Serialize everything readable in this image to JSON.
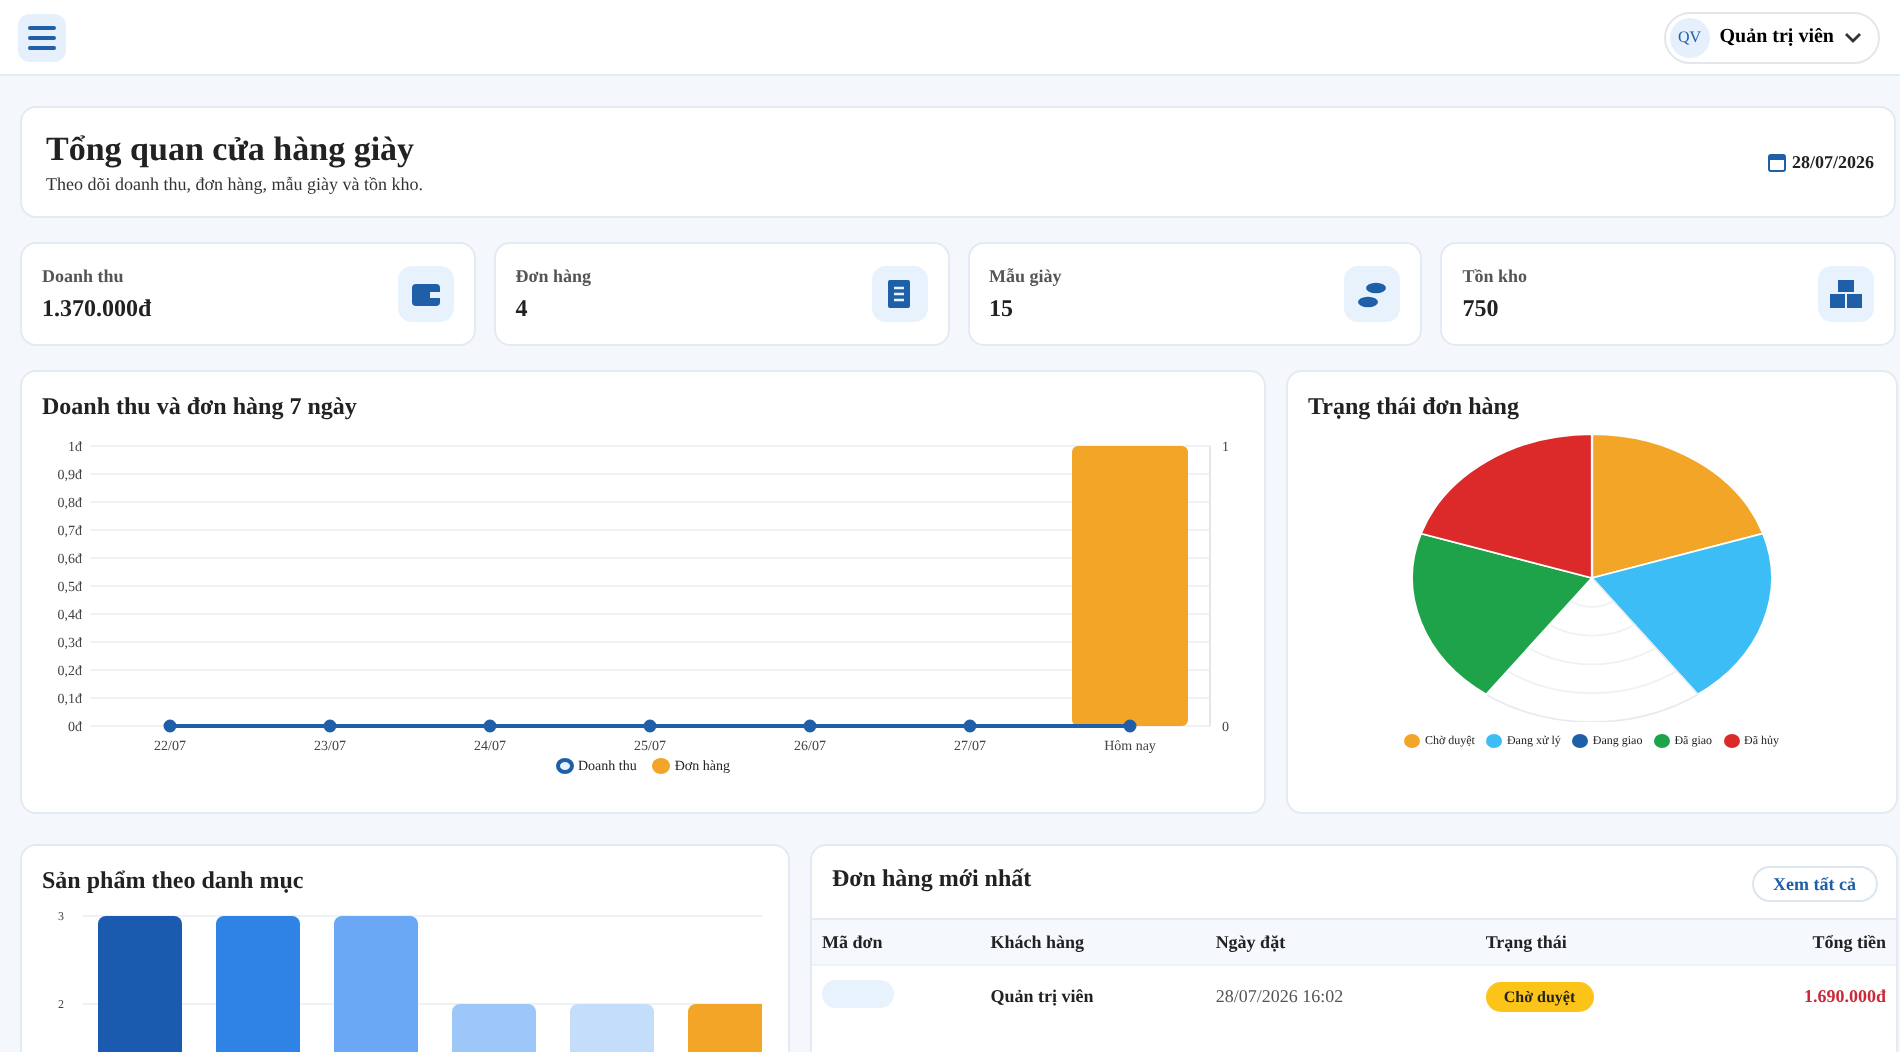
{
  "topbar": {
    "user": {
      "initials": "QV",
      "name": "Quản trị viên"
    }
  },
  "header": {
    "title": "Tổng quan cửa hàng giày",
    "subtitle": "Theo dõi doanh thu, đơn hàng, mẫu giày và tồn kho.",
    "date": "28/07/2026"
  },
  "stats": [
    {
      "label": "Doanh thu",
      "value": "1.370.000đ",
      "kind": "wallet"
    },
    {
      "label": "Đơn hàng",
      "value": "4",
      "kind": "receipt"
    },
    {
      "label": "Mẫu giày",
      "value": "15",
      "kind": "shoe"
    },
    {
      "label": "Tồn kho",
      "value": "750",
      "kind": "boxes"
    }
  ],
  "revenue_chart": {
    "title": "Doanh thu và đơn hàng 7 ngày",
    "chart_data": {
      "type": "bar",
      "categories": [
        "22/07",
        "23/07",
        "24/07",
        "25/07",
        "26/07",
        "27/07",
        "Hôm nay"
      ],
      "series": [
        {
          "name": "Doanh thu",
          "color": "#1f5fa8",
          "type": "line",
          "marker": true,
          "values": [
            0,
            0,
            0,
            0,
            0,
            0,
            0
          ]
        },
        {
          "name": "Đơn hàng",
          "color": "#f2a526",
          "type": "bar",
          "values": [
            0,
            0,
            0,
            0,
            0,
            0,
            1
          ]
        }
      ],
      "grid": true,
      "ylim": [
        0,
        1
      ],
      "yticks": [
        {
          "value": 0,
          "label": "0đ"
        },
        {
          "value": 0.1,
          "label": "0,1đ"
        },
        {
          "value": 0.2,
          "label": "0,2đ"
        },
        {
          "value": 0.3,
          "label": "0,3đ"
        },
        {
          "value": 0.4,
          "label": "0,4đ"
        },
        {
          "value": 0.5,
          "label": "0,5đ"
        },
        {
          "value": 0.6,
          "label": "0,6đ"
        },
        {
          "value": 0.7,
          "label": "0,7đ"
        },
        {
          "value": 0.8,
          "label": "0,8đ"
        },
        {
          "value": 0.9,
          "label": "0,9đ"
        },
        {
          "value": 1,
          "label": "1đ"
        }
      ],
      "y2lim": [
        0,
        1
      ],
      "y2ticks": [
        0,
        1
      ]
    }
  },
  "status_chart": {
    "title": "Trạng thái đơn hàng",
    "segments": [
      {
        "filled": true
      },
      {
        "filled": true
      },
      {
        "filled": false
      },
      {
        "filled": true
      },
      {
        "filled": true
      }
    ],
    "legend": [
      {
        "label": "Chờ duyệt",
        "color": "#f2a526"
      },
      {
        "label": "Đang xử lý",
        "color": "#3dbdf6"
      },
      {
        "label": "Đang giao",
        "color": "#1f5fa8"
      },
      {
        "label": "Đã giao",
        "color": "#1ea34a"
      },
      {
        "label": "Đã hủy",
        "color": "#dc2a2a"
      }
    ]
  },
  "category_chart": {
    "title": "Sản phẩm theo danh mục",
    "chart_data": {
      "type": "bar",
      "values": [
        3,
        3,
        3,
        2,
        2,
        2
      ],
      "colors": [
        "#1a5bb0",
        "#2f82e6",
        "#6aa8f6",
        "#9cc7f8",
        "#c4ddfa",
        "#f2a526"
      ],
      "ylim": [
        0,
        3
      ],
      "yticks": [
        2,
        3
      ]
    }
  },
  "orders": {
    "title": "Đơn hàng mới nhất",
    "view_all": "Xem tất cả",
    "columns": [
      "Mã đơn",
      "Khách hàng",
      "Ngày đặt",
      "Trạng thái",
      "Tổng tiền"
    ],
    "rows": [
      {
        "customer": "Quản trị viên",
        "date": "28/07/2026 16:02",
        "status": "Chờ duyệt",
        "color": "#fcc419",
        "total": "1.690.000đ"
      }
    ]
  }
}
